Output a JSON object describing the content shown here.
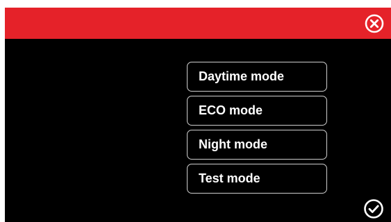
{
  "top_bar": {
    "color": "#e52229",
    "close_icon": "close-circle-icon"
  },
  "menu": {
    "items": [
      {
        "label": "Daytime mode"
      },
      {
        "label": "ECO mode"
      },
      {
        "label": "Night mode"
      },
      {
        "label": "Test mode"
      }
    ]
  },
  "footer": {
    "confirm_icon": "check-circle-icon"
  }
}
